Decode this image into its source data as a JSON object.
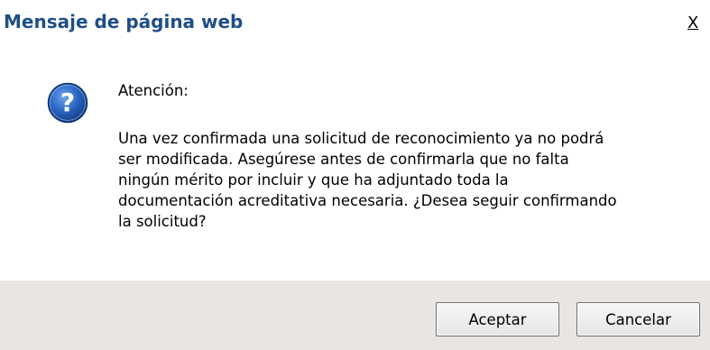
{
  "window": {
    "title": "Mensaje de página web",
    "close_label": "X"
  },
  "message": {
    "icon": "question-icon",
    "heading": "Atención:",
    "body_lines": [
      "Una vez confirmada una solicitud de reconocimiento ya no podrá",
      "ser modificada. Asegúrese antes de confirmarla que no falta",
      "ningún mérito por incluir y que ha adjuntado toda la",
      "documentación acreditativa necesaria. ¿Desea seguir confirmando",
      "la solicitud?"
    ]
  },
  "buttons": {
    "accept_label": "Aceptar",
    "cancel_label": "Cancelar"
  },
  "colors": {
    "title_text": "#1f4e86",
    "footer_bg": "#e9e6e1",
    "icon_blue": "#1c5cb8"
  }
}
